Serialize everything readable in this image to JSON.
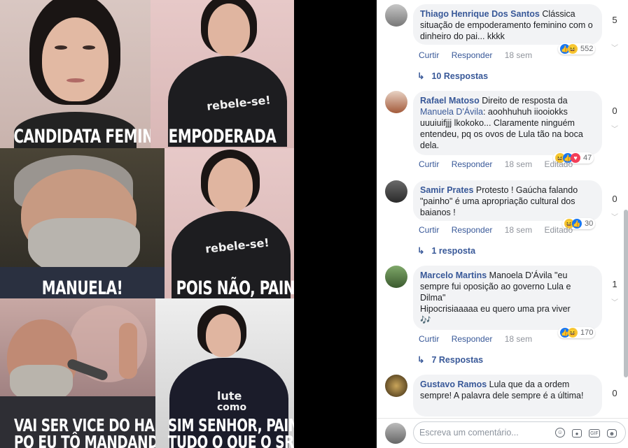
{
  "meme": {
    "captions": [
      "CANDIDATA FEMINISTA",
      "EMPODERADA",
      "MANUELA!",
      "POIS NÃO, PAINHO",
      "VAI SER VICE DO HADDAD",
      "PQ EU TÔ MANDANDO",
      "SIM SENHOR, PAINHO",
      "TUDO O QUE O SR QUISER"
    ],
    "shirt_text": "rebele-se!",
    "shirt_text_2": "lute",
    "shirt_text_3": "como"
  },
  "comments": [
    {
      "author": "Thiago Henrique Dos Santos",
      "text": "Clássica situação de empoderamento feminino com o dinheiro do pai... kkkk",
      "like_label": "Curtir",
      "reply_label": "Responder",
      "time": "18 sem",
      "edited": "",
      "reaction_count": "552",
      "vote": "5",
      "replies": "10 Respostas"
    },
    {
      "author": "Rafael Matoso",
      "text_before": "Direito de resposta da",
      "mention": "Manuela D'Ávila",
      "text": ": aoohhuhuh iiooiokks uuuiuifjjj lkokoko... Claramente ninguém entendeu, pq os ovos de Lula tão na boca dela.",
      "like_label": "Curtir",
      "reply_label": "Responder",
      "time": "18 sem",
      "edited": "Editado",
      "reaction_count": "47",
      "vote": "0",
      "replies": ""
    },
    {
      "author": "Samir Prates",
      "text": "Protesto ! Gaúcha falando \"painho\" é uma apropriação cultural dos baianos !",
      "like_label": "Curtir",
      "reply_label": "Responder",
      "time": "18 sem",
      "edited": "Editado",
      "reaction_count": "30",
      "vote": "0",
      "replies": "1 resposta"
    },
    {
      "author": "Marcelo Martins",
      "text": "Manoela D'Ávila \"eu sempre fui oposição ao governo Lula e Dilma\"",
      "text2": "Hipocrisiaaaaa eu quero uma pra viver",
      "text3": "🎶",
      "like_label": "Curtir",
      "reply_label": "Responder",
      "time": "18 sem",
      "edited": "",
      "reaction_count": "170",
      "vote": "1",
      "replies": "7 Respostas"
    },
    {
      "author": "Gustavo Ramos",
      "text": "Lula que da a ordem sempre! A palavra dele sempre é a última!",
      "vote": "0"
    }
  ],
  "composer": {
    "placeholder": "Escreva um comentário...",
    "icons": [
      "emoji-icon",
      "camera-icon",
      "gif-icon",
      "sticker-icon"
    ],
    "gif_label": "GIF"
  },
  "colors": {
    "link": "#385898",
    "bubble": "#f2f3f5",
    "meta": "#90949c",
    "like": "#1877f2",
    "haha": "#f7c835"
  }
}
